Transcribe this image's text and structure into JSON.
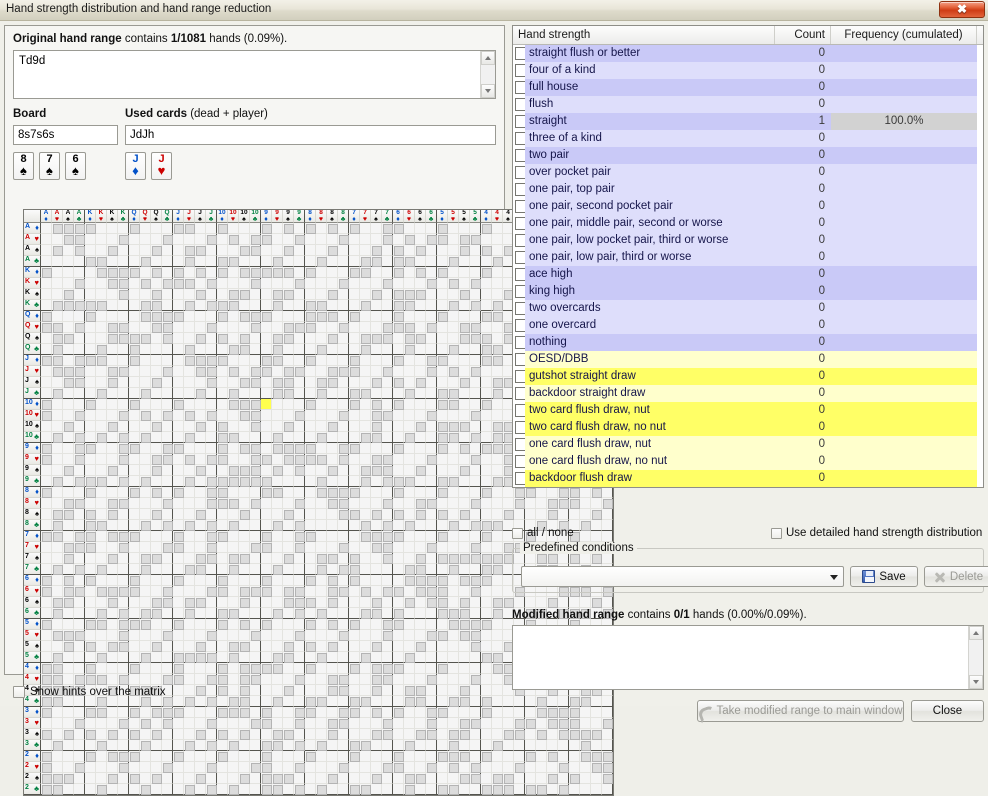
{
  "window": {
    "title": "Hand strength distribution and hand range reduction",
    "close_glyph": "✖"
  },
  "left": {
    "original_range": {
      "label_bold": "Original hand range",
      "label_rest": " contains ",
      "count_bold": "1/1081",
      "label_tail": " hands (0.09%).",
      "value": "Td9d"
    },
    "board": {
      "label": "Board",
      "value": "8s7s6s",
      "cards": [
        {
          "rank": "8",
          "suit": "♠",
          "suit_class": "sp"
        },
        {
          "rank": "7",
          "suit": "♠",
          "suit_class": "sp"
        },
        {
          "rank": "6",
          "suit": "♠",
          "suit_class": "sp"
        }
      ]
    },
    "used_cards": {
      "label_bold": "Used cards",
      "label_rest": " (dead + player)",
      "value": "JdJh",
      "cards": [
        {
          "rank": "J",
          "suit": "♦",
          "suit_class": "di"
        },
        {
          "rank": "J",
          "suit": "♥",
          "suit_class": "he"
        }
      ]
    },
    "matrix": {
      "ranks": [
        "A",
        "K",
        "Q",
        "J",
        "10",
        "9",
        "8",
        "7",
        "6",
        "5",
        "4",
        "3",
        "2"
      ],
      "suits": [
        {
          "glyph": "♦",
          "cls": "di"
        },
        {
          "glyph": "♥",
          "cls": "he"
        },
        {
          "glyph": "♠",
          "cls": "sp"
        },
        {
          "glyph": "♣",
          "cls": "cl"
        }
      ],
      "selected_cell": {
        "row_rank": "10",
        "row_suit": "♦",
        "col_rank": "9",
        "col_suit": "♦"
      }
    },
    "show_hints": {
      "label": "Show hints over the matrix",
      "checked": false
    }
  },
  "right": {
    "table": {
      "headers": [
        "Hand strength",
        "Count",
        "Frequency (cumulated)"
      ],
      "rows": [
        {
          "name": "straight flush or better",
          "count": "0",
          "freq": "",
          "style": "va"
        },
        {
          "name": "four of a kind",
          "count": "0",
          "freq": "",
          "style": "vb"
        },
        {
          "name": "full house",
          "count": "0",
          "freq": "",
          "style": "va"
        },
        {
          "name": "flush",
          "count": "0",
          "freq": "",
          "style": "vb"
        },
        {
          "name": "straight",
          "count": "1",
          "freq": "100.0%",
          "style": "va",
          "freq_hl": true
        },
        {
          "name": "three of a kind",
          "count": "0",
          "freq": "",
          "style": "vb"
        },
        {
          "name": "two pair",
          "count": "0",
          "freq": "",
          "style": "va"
        },
        {
          "name": "over pocket pair",
          "count": "0",
          "freq": "",
          "style": "vb"
        },
        {
          "name": "one pair, top pair",
          "count": "0",
          "freq": "",
          "style": "vb"
        },
        {
          "name": "one pair, second pocket pair",
          "count": "0",
          "freq": "",
          "style": "vb"
        },
        {
          "name": "one pair, middle pair, second or worse",
          "count": "0",
          "freq": "",
          "style": "vb"
        },
        {
          "name": "one pair, low pocket pair, third or worse",
          "count": "0",
          "freq": "",
          "style": "vb"
        },
        {
          "name": "one pair, low pair, third or worse",
          "count": "0",
          "freq": "",
          "style": "vb"
        },
        {
          "name": "ace high",
          "count": "0",
          "freq": "",
          "style": "va"
        },
        {
          "name": "king high",
          "count": "0",
          "freq": "",
          "style": "va"
        },
        {
          "name": "two overcards",
          "count": "0",
          "freq": "",
          "style": "vb"
        },
        {
          "name": "one overcard",
          "count": "0",
          "freq": "",
          "style": "vb"
        },
        {
          "name": "nothing",
          "count": "0",
          "freq": "",
          "style": "va"
        },
        {
          "name": "OESD/DBB",
          "count": "0",
          "freq": "",
          "style": "yb"
        },
        {
          "name": "gutshot straight draw",
          "count": "0",
          "freq": "",
          "style": "ya"
        },
        {
          "name": "backdoor straight draw",
          "count": "0",
          "freq": "",
          "style": "yb"
        },
        {
          "name": "two card flush draw, nut",
          "count": "0",
          "freq": "",
          "style": "ya"
        },
        {
          "name": "two card flush draw, no nut",
          "count": "0",
          "freq": "",
          "style": "ya"
        },
        {
          "name": "one card flush draw, nut",
          "count": "0",
          "freq": "",
          "style": "yb"
        },
        {
          "name": "one card flush draw, no nut",
          "count": "0",
          "freq": "",
          "style": "yb"
        },
        {
          "name": "backdoor flush draw",
          "count": "0",
          "freq": "",
          "style": "ya"
        }
      ]
    },
    "all_none": {
      "label": "all / none",
      "checked": false
    },
    "use_detailed": {
      "label": "Use detailed hand strength distribution",
      "checked": false
    },
    "predefined": {
      "legend": "Predefined conditions",
      "selected": "",
      "save_label": "Save",
      "delete_label": "Delete"
    },
    "modified_range": {
      "label_bold": "Modified hand range",
      "label_rest": " contains ",
      "count_bold": "0/1",
      "label_tail": " hands (0.00%/0.09%).",
      "value": ""
    },
    "take_button": "Take modified range to main window",
    "close_button": "Close"
  },
  "colors": {
    "made_hand_row_a": "#c9c9f7",
    "made_hand_row_b": "#dedefb",
    "draw_row_a": "#ffff66",
    "draw_row_b": "#ffffcc",
    "selected_cell": "#ffff4d",
    "close_red": "#cf3c15"
  }
}
